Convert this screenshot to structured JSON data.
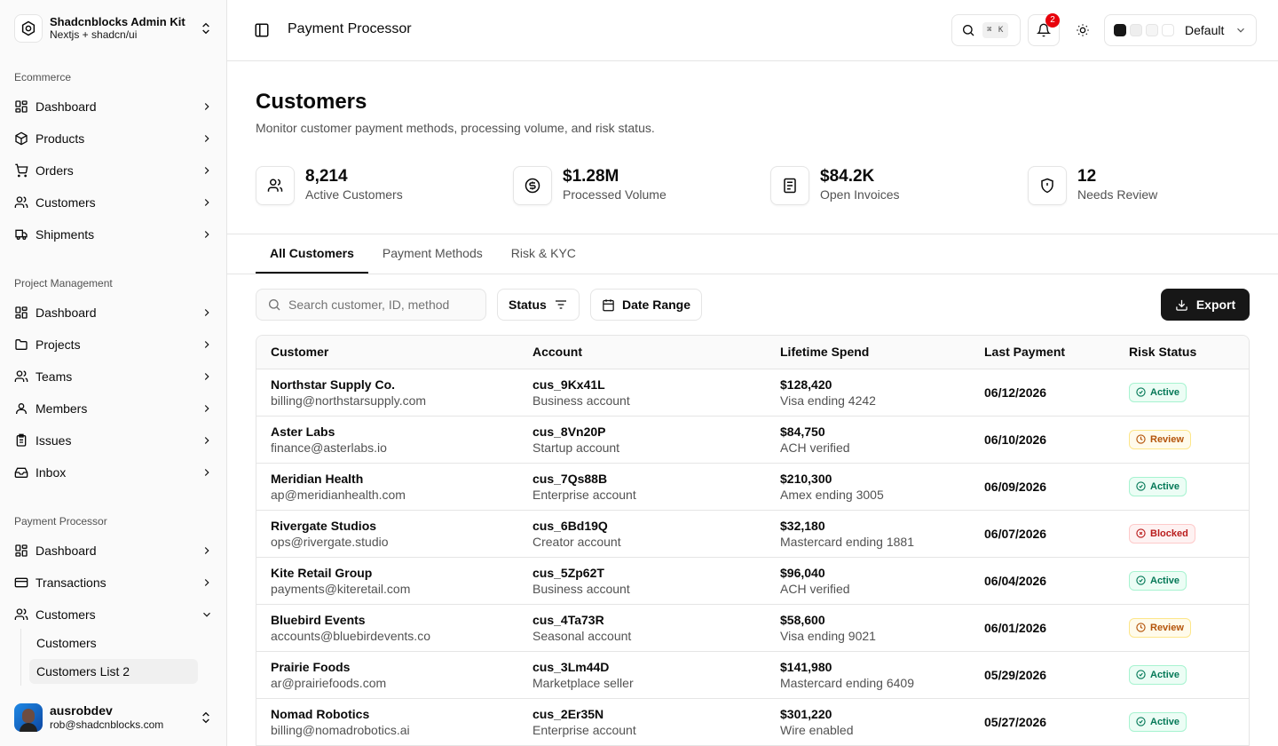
{
  "brand": {
    "title": "Shadcnblocks Admin Kit",
    "subtitle": "Nextjs + shadcn/ui"
  },
  "sidebar": {
    "groups": [
      {
        "label": "Ecommerce",
        "items": [
          "Dashboard",
          "Products",
          "Orders",
          "Customers",
          "Shipments"
        ]
      },
      {
        "label": "Project Management",
        "items": [
          "Dashboard",
          "Projects",
          "Teams",
          "Members",
          "Issues",
          "Inbox"
        ]
      },
      {
        "label": "Payment Processor",
        "items": [
          "Dashboard",
          "Transactions",
          "Customers"
        ]
      }
    ],
    "sub_items": [
      "Customers",
      "Customers List 2"
    ]
  },
  "user": {
    "name": "ausrobdev",
    "email": "rob@shadcnblocks.com"
  },
  "header": {
    "title": "Payment Processor",
    "search_kbd": "⌘ K",
    "notifications": "2",
    "theme": "Default",
    "swatches": [
      "#171717",
      "#eeeeee",
      "#f5f5f5",
      "#ffffff"
    ]
  },
  "page": {
    "title": "Customers",
    "description": "Monitor customer payment methods, processing volume, and risk status.",
    "stats": [
      {
        "value": "8,214",
        "label": "Active Customers",
        "icon": "users-icon"
      },
      {
        "value": "$1.28M",
        "label": "Processed Volume",
        "icon": "dollar-circle-icon"
      },
      {
        "value": "$84.2K",
        "label": "Open Invoices",
        "icon": "invoice-icon"
      },
      {
        "value": "12",
        "label": "Needs Review",
        "icon": "shield-icon"
      }
    ],
    "tabs": [
      "All Customers",
      "Payment Methods",
      "Risk & KYC"
    ],
    "active_tab": "All Customers"
  },
  "toolbar": {
    "search_placeholder": "Search customer, ID, method",
    "status_label": "Status",
    "date_range_label": "Date Range",
    "export_label": "Export"
  },
  "table": {
    "columns": [
      "Customer",
      "Account",
      "Lifetime Spend",
      "Last Payment",
      "Risk Status"
    ],
    "rows": [
      {
        "name": "Northstar Supply Co.",
        "email": "billing@northstarsupply.com",
        "id": "cus_9Kx41L",
        "account": "Business account",
        "spend": "$128,420",
        "method": "Visa ending 4242",
        "date": "06/12/2026",
        "status": "Active"
      },
      {
        "name": "Aster Labs",
        "email": "finance@asterlabs.io",
        "id": "cus_8Vn20P",
        "account": "Startup account",
        "spend": "$84,750",
        "method": "ACH verified",
        "date": "06/10/2026",
        "status": "Review"
      },
      {
        "name": "Meridian Health",
        "email": "ap@meridianhealth.com",
        "id": "cus_7Qs88B",
        "account": "Enterprise account",
        "spend": "$210,300",
        "method": "Amex ending 3005",
        "date": "06/09/2026",
        "status": "Active"
      },
      {
        "name": "Rivergate Studios",
        "email": "ops@rivergate.studio",
        "id": "cus_6Bd19Q",
        "account": "Creator account",
        "spend": "$32,180",
        "method": "Mastercard ending 1881",
        "date": "06/07/2026",
        "status": "Blocked"
      },
      {
        "name": "Kite Retail Group",
        "email": "payments@kiteretail.com",
        "id": "cus_5Zp62T",
        "account": "Business account",
        "spend": "$96,040",
        "method": "ACH verified",
        "date": "06/04/2026",
        "status": "Active"
      },
      {
        "name": "Bluebird Events",
        "email": "accounts@bluebirdevents.co",
        "id": "cus_4Ta73R",
        "account": "Seasonal account",
        "spend": "$58,600",
        "method": "Visa ending 9021",
        "date": "06/01/2026",
        "status": "Review"
      },
      {
        "name": "Prairie Foods",
        "email": "ar@prairiefoods.com",
        "id": "cus_3Lm44D",
        "account": "Marketplace seller",
        "spend": "$141,980",
        "method": "Mastercard ending 6409",
        "date": "05/29/2026",
        "status": "Active"
      },
      {
        "name": "Nomad Robotics",
        "email": "billing@nomadrobotics.ai",
        "id": "cus_2Er35N",
        "account": "Enterprise account",
        "spend": "$301,220",
        "method": "Wire enabled",
        "date": "05/27/2026",
        "status": "Active"
      }
    ]
  },
  "colors": {
    "accent": "#171717",
    "active": "#047857",
    "review": "#b45309",
    "blocked": "#b91c1c",
    "notification": "#e7000b"
  }
}
